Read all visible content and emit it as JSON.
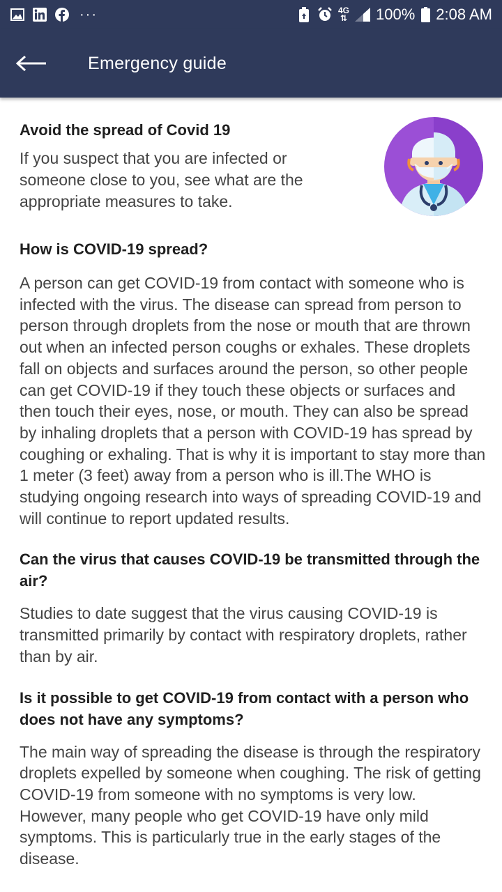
{
  "status_bar": {
    "network": "4G",
    "battery": "100%",
    "time": "2:08 AM",
    "left_icons": [
      "gallery-icon",
      "linkedin-icon",
      "facebook-icon",
      "more-dots-icon"
    ],
    "right_icons": [
      "battery-saver-icon",
      "alarm-icon",
      "network-4g-icon",
      "signal-icon",
      "battery-icon"
    ]
  },
  "appbar": {
    "title": "Emergency guide",
    "back_icon": "arrow-left-icon",
    "color": "#2f3a5b"
  },
  "intro": {
    "title": "Avoid the spread of Covid 19",
    "text": "If you suspect that you are infected or someone close to you, see what are the appropriate measures to take.",
    "avatar_icon": "doctor-avatar-icon",
    "avatar_color": "#9b4fd6"
  },
  "faq": [
    {
      "question": "How is COVID-19 spread?",
      "answer": "A person can get COVID-19 from contact with someone who is infected with the virus. The disease can spread from person to person through droplets from the nose or mouth that are thrown out when an infected person coughs or exhales. These droplets fall on objects and surfaces around the person, so other people can get COVID-19 if they touch these objects or surfaces and then touch their eyes, nose, or mouth. They can also be spread by inhaling droplets that a person with COVID-19 has spread by coughing or exhaling. That is why it is important to stay more than 1 meter (3 feet) away from a person who is ill.The WHO is studying ongoing research into ways of spreading COVID-19 and will continue to report updated results."
    },
    {
      "question": "Can the virus that causes COVID-19 be transmitted through the air?",
      "answer": "Studies to date suggest that the virus causing COVID-19 is transmitted primarily by contact with respiratory droplets, rather than by air."
    },
    {
      "question": "Is it possible to get COVID-19 from contact with a person who does not have any symptoms?",
      "answer": "The main way of spreading the disease is through the respiratory droplets expelled by someone when coughing. The risk of getting COVID-19 from someone with no symptoms is very low. However, many people who get COVID-19 have only mild symptoms. This is particularly true in the early stages of the disease."
    }
  ]
}
